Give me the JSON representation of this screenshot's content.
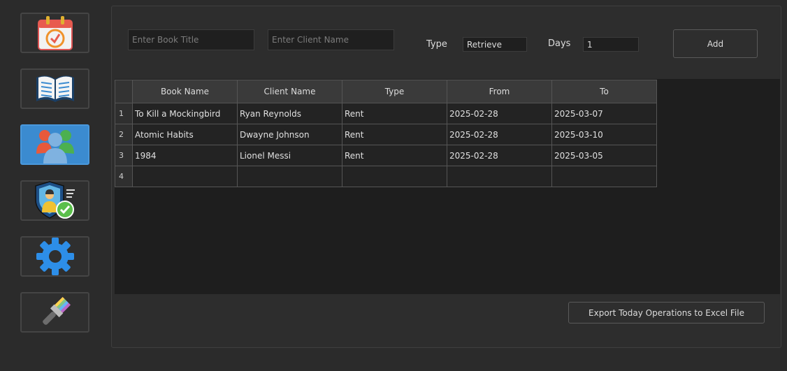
{
  "sidebar": {
    "items": [
      {
        "name": "calendar",
        "icon": "calendar-icon"
      },
      {
        "name": "books",
        "icon": "open-book-icon"
      },
      {
        "name": "clients",
        "icon": "users-icon",
        "active": true
      },
      {
        "name": "security",
        "icon": "security-user-icon"
      },
      {
        "name": "settings",
        "icon": "gear-icon"
      },
      {
        "name": "theme",
        "icon": "paint-brush-icon"
      }
    ]
  },
  "form": {
    "book_title_placeholder": "Enter Book Title",
    "client_name_placeholder": "Enter Client Name",
    "type_label": "Type",
    "type_value": "Retrieve",
    "days_label": "Days",
    "days_value": "1",
    "add_label": "Add"
  },
  "table": {
    "headers": [
      "Book Name",
      "Client Name",
      "Type",
      "From",
      "To"
    ],
    "rows": [
      {
        "num": "1",
        "book": "To Kill a Mockingbird",
        "client": "Ryan Reynolds",
        "type": "Rent",
        "from": "2025-02-28",
        "to": "2025-03-07"
      },
      {
        "num": "2",
        "book": "Atomic Habits",
        "client": "Dwayne Johnson",
        "type": "Rent",
        "from": "2025-02-28",
        "to": "2025-03-10"
      },
      {
        "num": "3",
        "book": "1984",
        "client": "Lionel Messi",
        "type": "Rent",
        "from": "2025-02-28",
        "to": "2025-03-05"
      },
      {
        "num": "4",
        "book": "",
        "client": "",
        "type": "",
        "from": "",
        "to": ""
      }
    ]
  },
  "export_label": "Export Today Operations to Excel File",
  "colors": {
    "background": "#2b2b2b",
    "active_accent": "#3b8bd0",
    "table_bg": "#1e1e1e"
  }
}
